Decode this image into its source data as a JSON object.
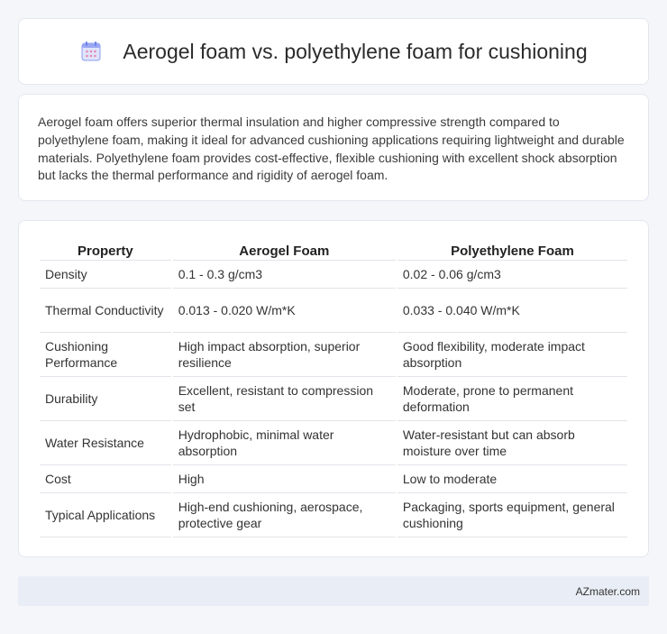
{
  "header": {
    "title": "Aerogel foam vs. polyethylene foam for cushioning",
    "icon": "calendar-icon"
  },
  "summary": {
    "text": "Aerogel foam offers superior thermal insulation and higher compressive strength compared to polyethylene foam, making it ideal for advanced cushioning applications requiring lightweight and durable materials. Polyethylene foam provides cost-effective, flexible cushioning with excellent shock absorption but lacks the thermal performance and rigidity of aerogel foam."
  },
  "table": {
    "headers": [
      "Property",
      "Aerogel Foam",
      "Polyethylene Foam"
    ],
    "rows": [
      [
        "Density",
        "0.1 - 0.3 g/cm3",
        "0.02 - 0.06 g/cm3"
      ],
      [
        "Thermal Conductivity",
        "0.013 - 0.020 W/m*K",
        "0.033 - 0.040 W/m*K"
      ],
      [
        "Cushioning Performance",
        "High impact absorption, superior resilience",
        "Good flexibility, moderate impact absorption"
      ],
      [
        "Durability",
        "Excellent, resistant to compression set",
        "Moderate, prone to permanent deformation"
      ],
      [
        "Water Resistance",
        "Hydrophobic, minimal water absorption",
        "Water-resistant but can absorb moisture over time"
      ],
      [
        "Cost",
        "High",
        "Low to moderate"
      ],
      [
        "Typical Applications",
        "High-end cushioning, aerospace, protective gear",
        "Packaging, sports equipment, general cushioning"
      ]
    ]
  },
  "footer": {
    "brand": "AZmater.com"
  },
  "colors": {
    "background": "#f4f6fa",
    "footer_bg": "#e9eef6",
    "icon_accent": "#7b8ef0"
  }
}
